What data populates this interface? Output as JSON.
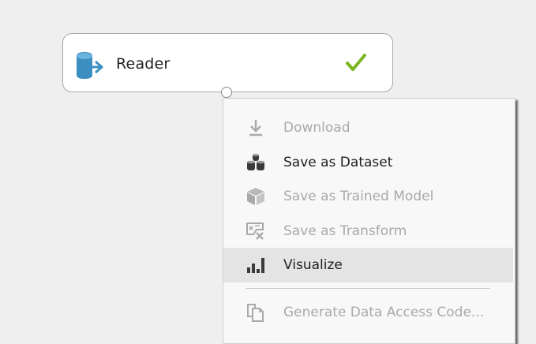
{
  "module": {
    "title": "Reader",
    "icon": "database-export-icon",
    "status_icon": "checkmark-icon",
    "colors": {
      "icon": "#3b8fc0",
      "status": "#7bb521"
    }
  },
  "context_menu": {
    "items": [
      {
        "label": "Download",
        "icon": "download-icon",
        "enabled": false
      },
      {
        "label": "Save as Dataset",
        "icon": "dataset-icon",
        "enabled": true
      },
      {
        "label": "Save as Trained Model",
        "icon": "cube-icon",
        "enabled": false
      },
      {
        "label": "Save as Transform",
        "icon": "transform-icon",
        "enabled": false
      },
      {
        "label": "Visualize",
        "icon": "bar-chart-icon",
        "enabled": true,
        "highlighted": true
      },
      {
        "label": "Generate Data Access Code...",
        "icon": "code-document-icon",
        "enabled": false
      }
    ]
  }
}
